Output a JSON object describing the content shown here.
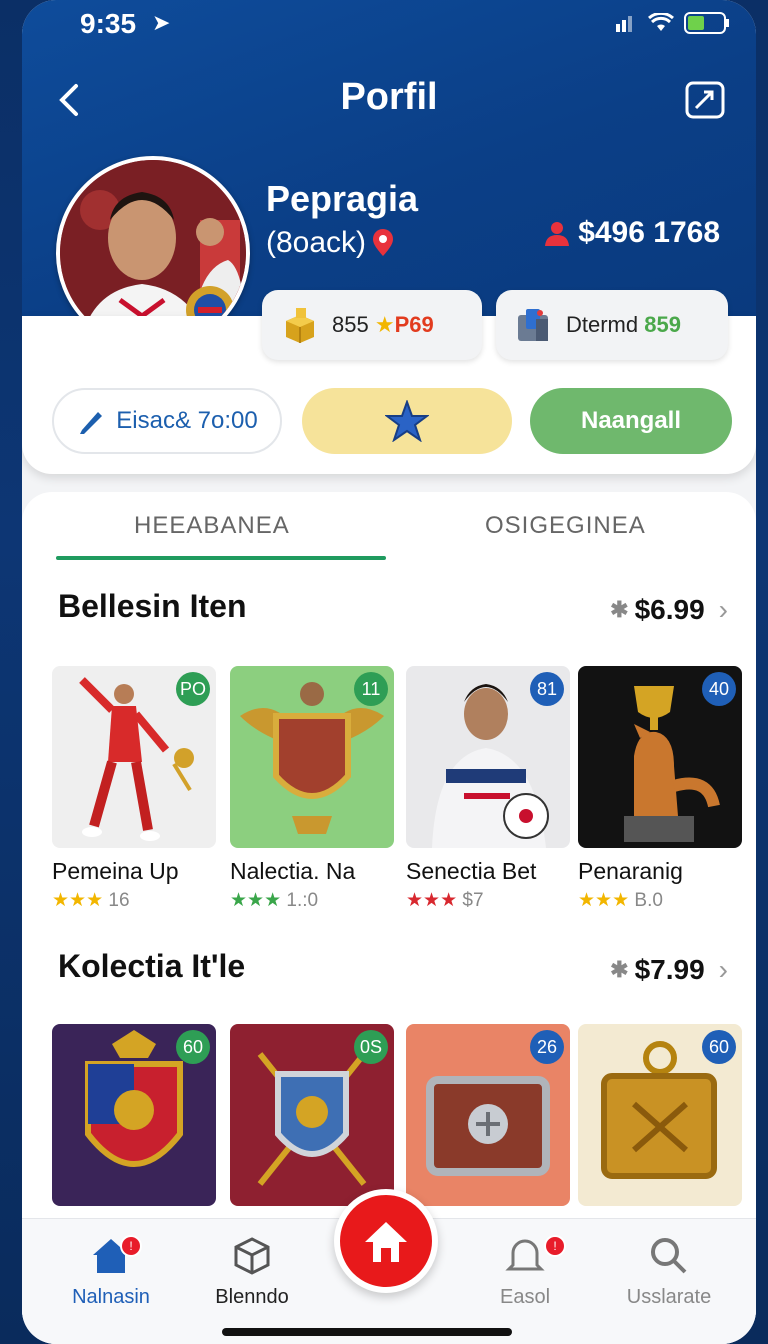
{
  "status": {
    "time": "9:35"
  },
  "header": {
    "title": "Porfil"
  },
  "profile": {
    "name": "Pepragia",
    "handle": "(8oack)",
    "balance": "$496 1768"
  },
  "stats": [
    {
      "value": "855",
      "accent": "P69"
    },
    {
      "value": "Dtermd",
      "accent": "859"
    }
  ],
  "actions": {
    "edit_label": "Eisac& 7o:00",
    "green_label": "Naangall"
  },
  "tabs": [
    {
      "label": "HEEABANEA"
    },
    {
      "label": "OSIGEGINEA"
    }
  ],
  "sections": [
    {
      "title": "Bellesin Iten",
      "price": "$6.99",
      "items": [
        {
          "name": "Pemeina Up",
          "badge": "PO",
          "stars": "★★★",
          "rating": "16"
        },
        {
          "name": "Nalectia. Na",
          "badge": "11",
          "stars": "★★★",
          "rating": "1.:0"
        },
        {
          "name": "Senectia Bet",
          "badge": "81",
          "stars": "★★★",
          "rating": "$7"
        },
        {
          "name": "Penaranig",
          "badge": "40",
          "stars": "★★★",
          "rating": "Β.0"
        }
      ]
    },
    {
      "title": "Kolectia It'le",
      "price": "$7.99",
      "items": [
        {
          "badge": "60"
        },
        {
          "badge": "0S"
        },
        {
          "badge": "26"
        },
        {
          "badge": "60"
        }
      ]
    }
  ],
  "bottom_nav": [
    {
      "label": "Nalnasin"
    },
    {
      "label": "Blenndo"
    },
    {
      "label": "Easol"
    },
    {
      "label": "Usslarate"
    }
  ],
  "colors": {
    "header_blue": "#0b3f87",
    "accent_green": "#1f9b5f",
    "fab_red": "#e8191b"
  }
}
